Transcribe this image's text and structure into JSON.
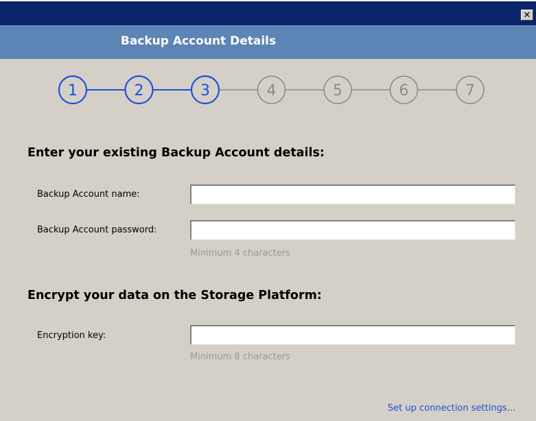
{
  "window": {
    "close_symbol": "✕",
    "header_title": "Backup Account Details"
  },
  "steps": {
    "labels": [
      "1",
      "2",
      "3",
      "4",
      "5",
      "6",
      "7"
    ],
    "current": 3,
    "active_color": "#1f4fd8",
    "inactive_color": "#8a8a8a"
  },
  "account": {
    "heading": "Enter your existing Backup Account details:",
    "name_label": "Backup Account name:",
    "name_value": "",
    "password_label": "Backup Account password:",
    "password_value": "",
    "password_hint": "Minimum 4 characters"
  },
  "encryption": {
    "heading": "Encrypt your data on the Storage Platform:",
    "key_label": "Encryption key:",
    "key_value": "",
    "key_hint": "Minimum 8 characters"
  },
  "footer": {
    "connection_link": "Set up connection settings..."
  }
}
